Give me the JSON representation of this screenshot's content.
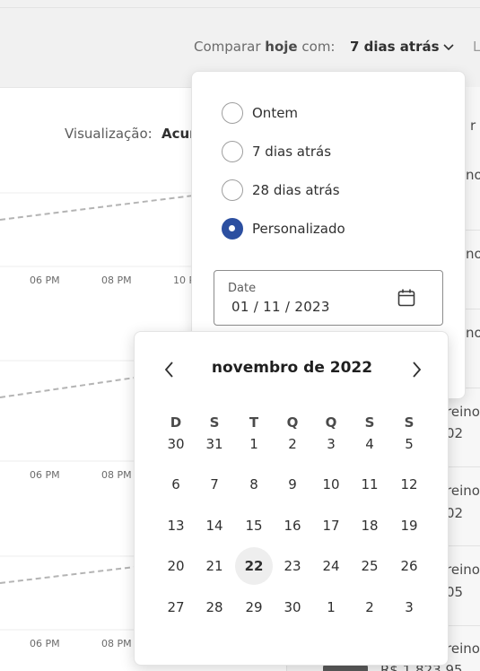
{
  "header": {
    "compare_prefix": "Comparar",
    "compare_bold": "hoje",
    "compare_suffix": "com:",
    "compare_value": "7 dias atrás",
    "cut_right": "L"
  },
  "chart": {
    "view_label": "Visualização:",
    "view_value": "Acum",
    "ticks_row1": [
      "06 PM",
      "08 PM",
      "10 P"
    ],
    "ticks_row2": [
      "06 PM",
      "08 PM"
    ],
    "ticks_row3": [
      "06 PM",
      "08 PM"
    ]
  },
  "right_panel": {
    "texts": [
      "r re",
      "no",
      "no",
      "no",
      "reino",
      "02",
      "reino",
      "02",
      "reino",
      "05",
      "reino",
      "R$ 1.823,95"
    ]
  },
  "compare_dropdown": {
    "options": [
      {
        "label": "Ontem",
        "checked": false
      },
      {
        "label": "7 dias atrás",
        "checked": false
      },
      {
        "label": "28 dias atrás",
        "checked": false
      },
      {
        "label": "Personalizado",
        "checked": true
      }
    ],
    "date_label": "Date",
    "date_value": "01 / 11 / 2023"
  },
  "calendar": {
    "title": "novembro de 2022",
    "weekdays": [
      "D",
      "S",
      "T",
      "Q",
      "Q",
      "S",
      "S"
    ],
    "weeks": [
      [
        "30",
        "31",
        "1",
        "2",
        "3",
        "4",
        "5"
      ],
      [
        "6",
        "7",
        "8",
        "9",
        "10",
        "11",
        "12"
      ],
      [
        "13",
        "14",
        "15",
        "16",
        "17",
        "18",
        "19"
      ],
      [
        "20",
        "21",
        "22",
        "23",
        "24",
        "25",
        "26"
      ],
      [
        "27",
        "28",
        "29",
        "30",
        "1",
        "2",
        "3"
      ]
    ],
    "highlighted_day": "22",
    "icons": {
      "prev": "chevron-left-icon",
      "next": "chevron-right-icon",
      "calendar": "calendar-icon"
    },
    "colors": {
      "accent": "#2c4fa0",
      "today_bg": "#eeeeee"
    }
  }
}
